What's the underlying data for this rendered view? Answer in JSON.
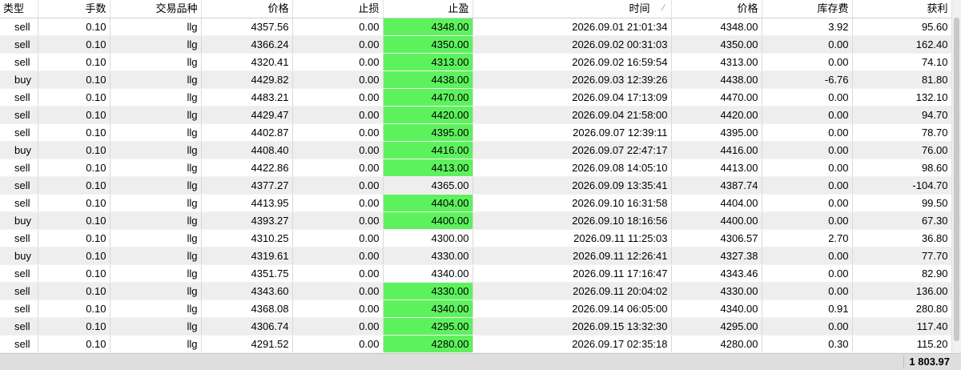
{
  "header": {
    "type": "类型",
    "volume": "手数",
    "symbol": "交易品种",
    "open_price": "价格",
    "sl": "止损",
    "tp": "止盈",
    "time": "时间",
    "close_price": "价格",
    "swap": "库存费",
    "profit": "获利",
    "sort_indicator": "⁄"
  },
  "rows": [
    {
      "type": "sell",
      "volume": "0.10",
      "symbol": "llg",
      "open_price": "4357.56",
      "sl": "0.00",
      "tp": "4348.00",
      "tp_hit": true,
      "time": "2026.09.01 21:01:34",
      "close_price": "4348.00",
      "swap": "3.92",
      "profit": "95.60"
    },
    {
      "type": "sell",
      "volume": "0.10",
      "symbol": "llg",
      "open_price": "4366.24",
      "sl": "0.00",
      "tp": "4350.00",
      "tp_hit": true,
      "time": "2026.09.02 00:31:03",
      "close_price": "4350.00",
      "swap": "0.00",
      "profit": "162.40"
    },
    {
      "type": "sell",
      "volume": "0.10",
      "symbol": "llg",
      "open_price": "4320.41",
      "sl": "0.00",
      "tp": "4313.00",
      "tp_hit": true,
      "time": "2026.09.02 16:59:54",
      "close_price": "4313.00",
      "swap": "0.00",
      "profit": "74.10"
    },
    {
      "type": "buy",
      "volume": "0.10",
      "symbol": "llg",
      "open_price": "4429.82",
      "sl": "0.00",
      "tp": "4438.00",
      "tp_hit": true,
      "time": "2026.09.03 12:39:26",
      "close_price": "4438.00",
      "swap": "-6.76",
      "profit": "81.80"
    },
    {
      "type": "sell",
      "volume": "0.10",
      "symbol": "llg",
      "open_price": "4483.21",
      "sl": "0.00",
      "tp": "4470.00",
      "tp_hit": true,
      "time": "2026.09.04 17:13:09",
      "close_price": "4470.00",
      "swap": "0.00",
      "profit": "132.10"
    },
    {
      "type": "sell",
      "volume": "0.10",
      "symbol": "llg",
      "open_price": "4429.47",
      "sl": "0.00",
      "tp": "4420.00",
      "tp_hit": true,
      "time": "2026.09.04 21:58:00",
      "close_price": "4420.00",
      "swap": "0.00",
      "profit": "94.70"
    },
    {
      "type": "sell",
      "volume": "0.10",
      "symbol": "llg",
      "open_price": "4402.87",
      "sl": "0.00",
      "tp": "4395.00",
      "tp_hit": true,
      "time": "2026.09.07 12:39:11",
      "close_price": "4395.00",
      "swap": "0.00",
      "profit": "78.70"
    },
    {
      "type": "buy",
      "volume": "0.10",
      "symbol": "llg",
      "open_price": "4408.40",
      "sl": "0.00",
      "tp": "4416.00",
      "tp_hit": true,
      "time": "2026.09.07 22:47:17",
      "close_price": "4416.00",
      "swap": "0.00",
      "profit": "76.00"
    },
    {
      "type": "sell",
      "volume": "0.10",
      "symbol": "llg",
      "open_price": "4422.86",
      "sl": "0.00",
      "tp": "4413.00",
      "tp_hit": true,
      "time": "2026.09.08 14:05:10",
      "close_price": "4413.00",
      "swap": "0.00",
      "profit": "98.60"
    },
    {
      "type": "sell",
      "volume": "0.10",
      "symbol": "llg",
      "open_price": "4377.27",
      "sl": "0.00",
      "tp": "4365.00",
      "tp_hit": false,
      "time": "2026.09.09 13:35:41",
      "close_price": "4387.74",
      "swap": "0.00",
      "profit": "-104.70"
    },
    {
      "type": "sell",
      "volume": "0.10",
      "symbol": "llg",
      "open_price": "4413.95",
      "sl": "0.00",
      "tp": "4404.00",
      "tp_hit": true,
      "time": "2026.09.10 16:31:58",
      "close_price": "4404.00",
      "swap": "0.00",
      "profit": "99.50"
    },
    {
      "type": "buy",
      "volume": "0.10",
      "symbol": "llg",
      "open_price": "4393.27",
      "sl": "0.00",
      "tp": "4400.00",
      "tp_hit": true,
      "time": "2026.09.10 18:16:56",
      "close_price": "4400.00",
      "swap": "0.00",
      "profit": "67.30"
    },
    {
      "type": "sell",
      "volume": "0.10",
      "symbol": "llg",
      "open_price": "4310.25",
      "sl": "0.00",
      "tp": "4300.00",
      "tp_hit": false,
      "time": "2026.09.11 11:25:03",
      "close_price": "4306.57",
      "swap": "2.70",
      "profit": "36.80"
    },
    {
      "type": "buy",
      "volume": "0.10",
      "symbol": "llg",
      "open_price": "4319.61",
      "sl": "0.00",
      "tp": "4330.00",
      "tp_hit": false,
      "time": "2026.09.11 12:26:41",
      "close_price": "4327.38",
      "swap": "0.00",
      "profit": "77.70"
    },
    {
      "type": "sell",
      "volume": "0.10",
      "symbol": "llg",
      "open_price": "4351.75",
      "sl": "0.00",
      "tp": "4340.00",
      "tp_hit": false,
      "time": "2026.09.11 17:16:47",
      "close_price": "4343.46",
      "swap": "0.00",
      "profit": "82.90"
    },
    {
      "type": "sell",
      "volume": "0.10",
      "symbol": "llg",
      "open_price": "4343.60",
      "sl": "0.00",
      "tp": "4330.00",
      "tp_hit": true,
      "time": "2026.09.11 20:04:02",
      "close_price": "4330.00",
      "swap": "0.00",
      "profit": "136.00"
    },
    {
      "type": "sell",
      "volume": "0.10",
      "symbol": "llg",
      "open_price": "4368.08",
      "sl": "0.00",
      "tp": "4340.00",
      "tp_hit": true,
      "time": "2026.09.14 06:05:00",
      "close_price": "4340.00",
      "swap": "0.91",
      "profit": "280.80"
    },
    {
      "type": "sell",
      "volume": "0.10",
      "symbol": "llg",
      "open_price": "4306.74",
      "sl": "0.00",
      "tp": "4295.00",
      "tp_hit": true,
      "time": "2026.09.15 13:32:30",
      "close_price": "4295.00",
      "swap": "0.00",
      "profit": "117.40"
    },
    {
      "type": "sell",
      "volume": "0.10",
      "symbol": "llg",
      "open_price": "4291.52",
      "sl": "0.00",
      "tp": "4280.00",
      "tp_hit": true,
      "time": "2026.09.17 02:35:18",
      "close_price": "4280.00",
      "swap": "0.30",
      "profit": "115.20"
    }
  ],
  "footer": {
    "total_profit": "1 803.97"
  },
  "colors": {
    "tp_hit": "#5df25d",
    "row_alt": "#eeeeee",
    "footer": "#dedede"
  }
}
